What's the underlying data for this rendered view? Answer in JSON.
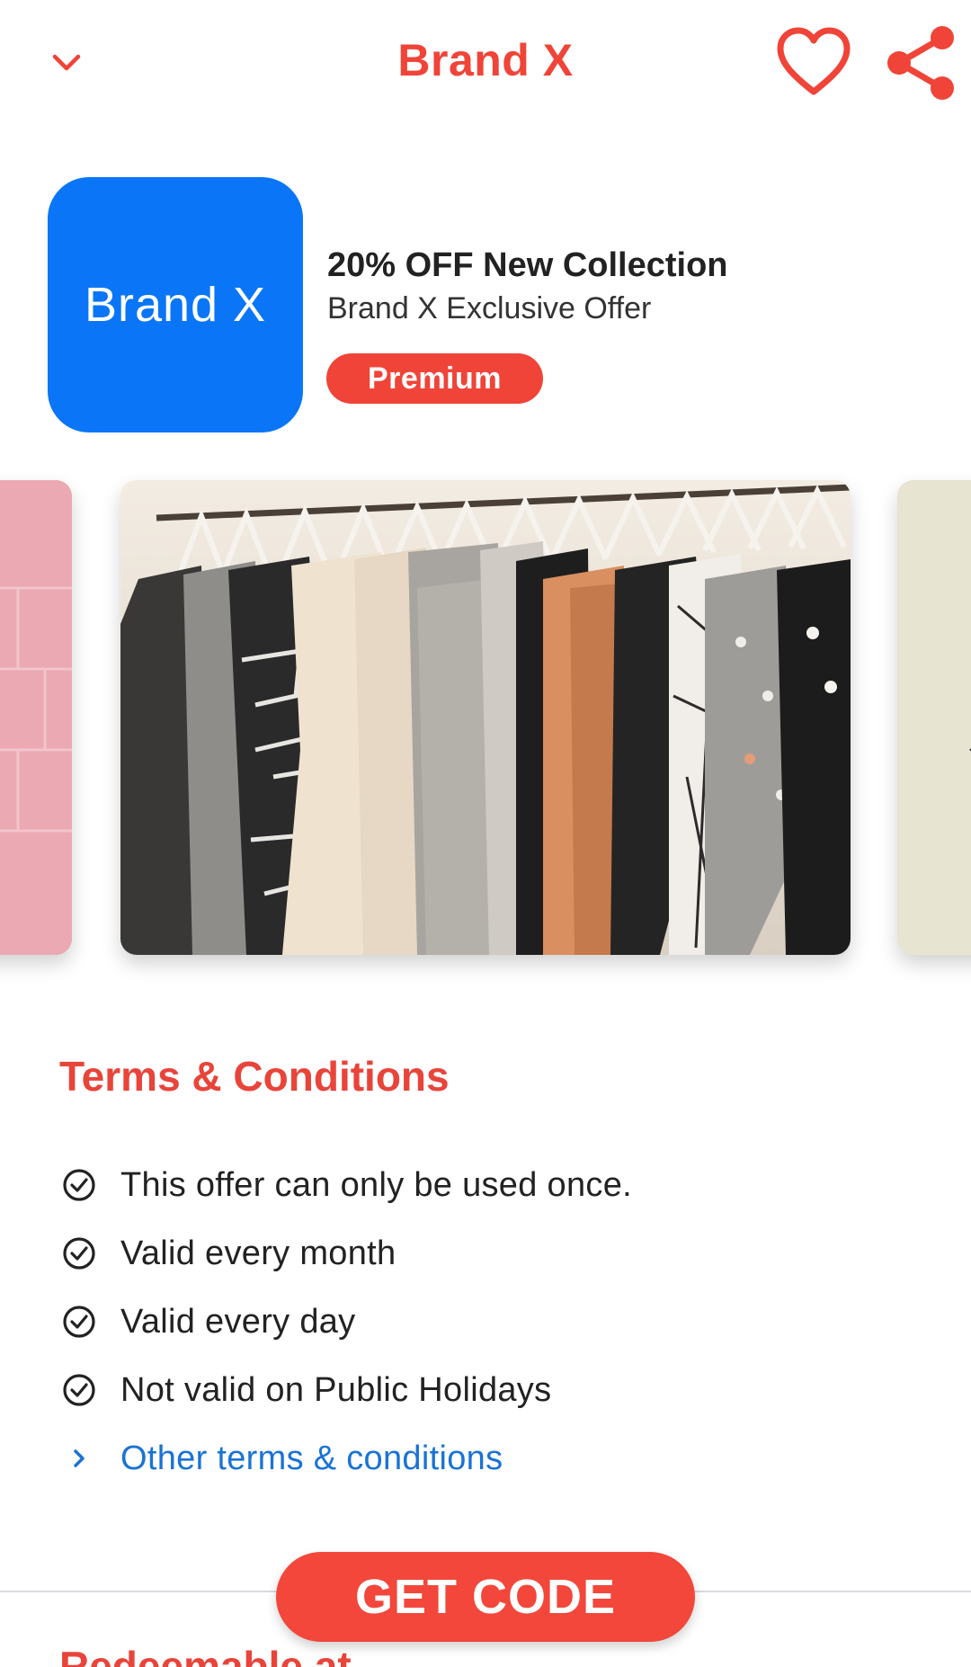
{
  "header": {
    "title": "Brand X",
    "back_icon": "chevron-down-icon",
    "favorite_icon": "heart-outline-icon",
    "share_icon": "share-icon",
    "accent_color": "#f04438"
  },
  "offer": {
    "logo_text": "Brand X",
    "logo_color": "#0a76f7",
    "title": "20% OFF New Collection",
    "subtitle": "Brand X Exclusive Offer",
    "badge": "Premium"
  },
  "carousel": {
    "images": [
      "pink-wall-image",
      "clothing-rack-image",
      "boutique-image"
    ]
  },
  "terms": {
    "title": "Terms & Conditions",
    "items": [
      "This offer can only be used once.",
      "Valid every month",
      "Valid every day",
      "Not valid on Public Holidays"
    ],
    "more_link": "Other terms & conditions"
  },
  "redeem": {
    "title": "Redeemable at"
  },
  "cta": {
    "label": "GET CODE"
  }
}
